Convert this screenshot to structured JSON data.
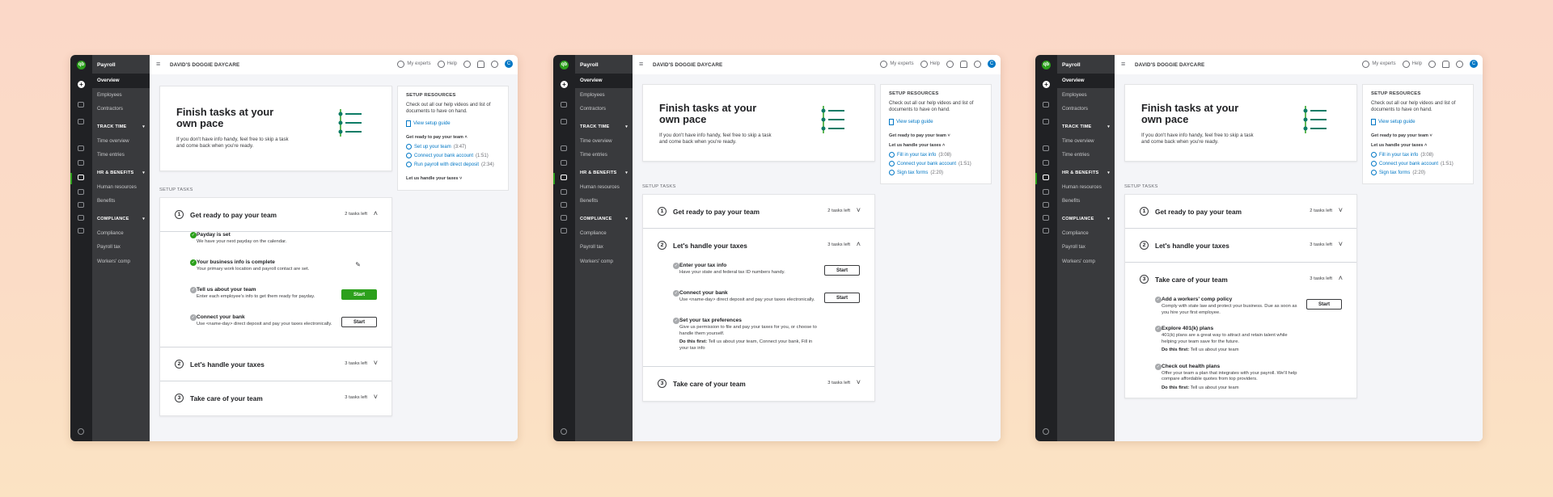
{
  "app": {
    "product": "Payroll",
    "company": "DAVID'S DOGGIE DAYCARE",
    "logo": "qb",
    "avatar": "C",
    "accent": "#2ca01c",
    "link_color": "#0077c5"
  },
  "topbar": {
    "my_experts": "My experts",
    "help": "Help",
    "icons": [
      "hamburger-icon",
      "person-icon",
      "help-icon",
      "search-icon",
      "bell-icon",
      "gear-icon"
    ]
  },
  "nav": {
    "overview": "Overview",
    "employees": "Employees",
    "contractors": "Contractors",
    "track_time": "TRACK TIME",
    "time_overview": "Time overview",
    "time_entries": "Time entries",
    "hr_benefits": "HR & BENEFITS",
    "human_resources": "Human resources",
    "benefits": "Benefits",
    "compliance": "COMPLIANCE",
    "compliance_item": "Compliance",
    "payroll_tax": "Payroll tax",
    "workers_comp": "Workers' comp"
  },
  "hero": {
    "title": "Finish tasks at your own pace",
    "desc": "If you don't have info handy, feel free to skip a task and come back when you're ready."
  },
  "resources": {
    "header": "SETUP RESOURCES",
    "desc": "Check out all our help videos and list of documents to have on hand.",
    "setup_guide": "View setup guide",
    "group_pay": "Get ready to pay your team",
    "group_taxes": "Let us handle your taxes",
    "pay_videos": [
      {
        "label": "Set up your team",
        "dur": "(3:47)"
      },
      {
        "label": "Connect your bank account",
        "dur": "(1:51)"
      },
      {
        "label": "Run payroll with direct deposit",
        "dur": "(2:34)"
      }
    ],
    "tax_videos": [
      {
        "label": "Fill in your tax info",
        "dur": "(3:08)"
      },
      {
        "label": "Connect your bank account",
        "dur": "(1:51)"
      },
      {
        "label": "Sign tax forms",
        "dur": "(2:20)"
      }
    ]
  },
  "setup_tasks_label": "SETUP TASKS",
  "sections": {
    "pay": {
      "num": "1",
      "title": "Get ready to pay your team",
      "left": "2 tasks left"
    },
    "taxes": {
      "num": "2",
      "title": "Let's handle your taxes",
      "left": "3 tasks left"
    },
    "care": {
      "num": "3",
      "title": "Take care of your team",
      "left": "3 tasks left"
    }
  },
  "pay_items": [
    {
      "title": "Payday is set",
      "desc": "We have your next payday on the calendar."
    },
    {
      "title": "Your business info is complete",
      "desc": "Your primary work location and payroll contact are set."
    },
    {
      "title": "Tell us about your team",
      "desc": "Enter each employee's info to get them ready for payday.",
      "btn": "Start"
    },
    {
      "title": "Connect your bank",
      "desc": "Use <name-day> direct deposit and pay your taxes electronically.",
      "btn": "Start"
    }
  ],
  "tax_items": [
    {
      "title": "Enter your tax info",
      "desc": "Have your state and federal tax ID numbers handy.",
      "btn": "Start"
    },
    {
      "title": "Connect your bank",
      "desc": "Use <name-day> direct deposit and pay your taxes electronically.",
      "btn": "Start"
    },
    {
      "title": "Set your tax preferences",
      "desc": "Give us permission to file and pay your taxes for you, or choose to handle them yourself.",
      "dofirst": "Do this first:",
      "dofirst_text": "Tell us about your team, Connect your bank, Fill in your tax info"
    }
  ],
  "care_items": [
    {
      "title": "Add a workers' comp policy",
      "desc": "Comply with state law and protect your business. Due as soon as you hire your first employee.",
      "btn": "Start"
    },
    {
      "title": "Explore 401(k) plans",
      "desc": "401(k) plans are a great way to attract and retain talent while helping your team save for the future.",
      "dofirst": "Do this first:",
      "dofirst_text": "Tell us about your team"
    },
    {
      "title": "Check out health plans",
      "desc": "Offer your team a plan that integrates with your payroll. We'll help compare affordable quotes from top providers.",
      "dofirst": "Do this first:",
      "dofirst_text": "Tell us about your team"
    }
  ]
}
